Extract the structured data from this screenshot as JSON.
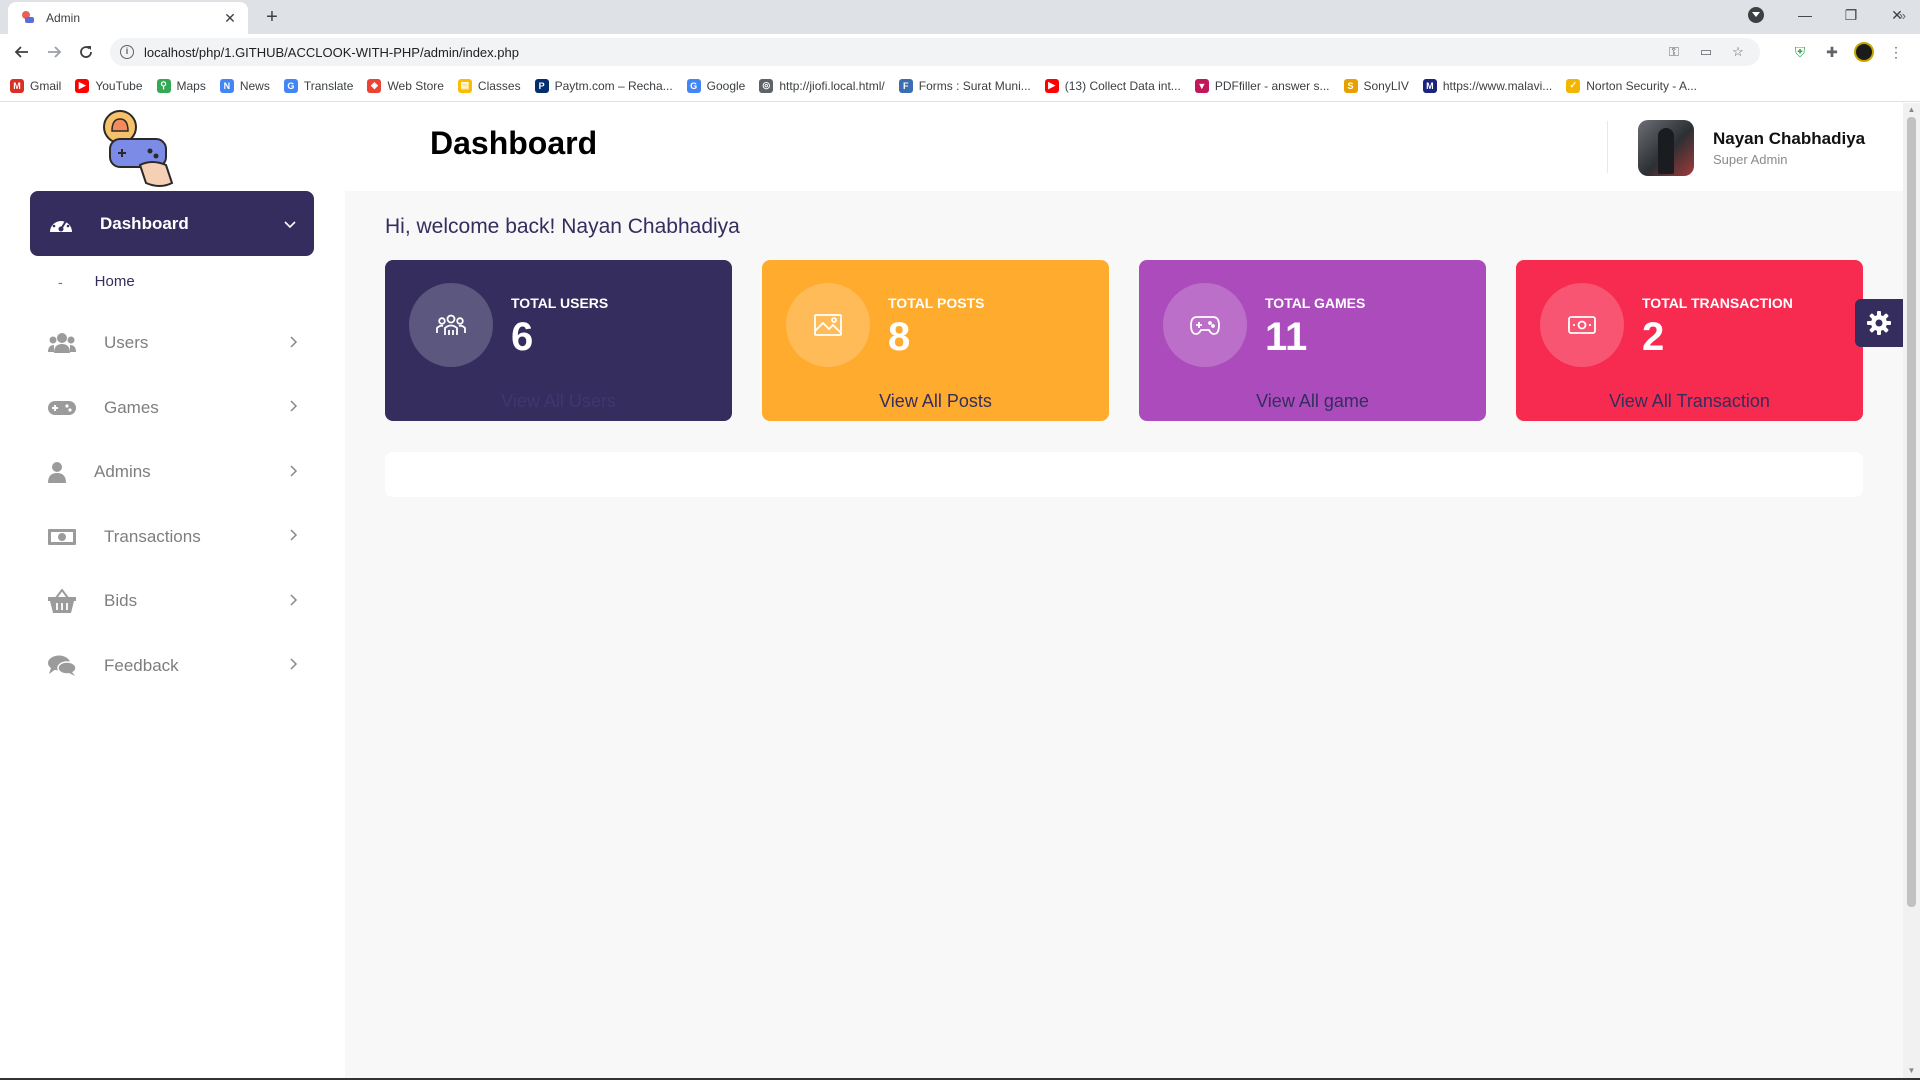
{
  "browser": {
    "tab_title": "Admin",
    "tab_close": "✕",
    "new_tab": "+",
    "url": "localhost/php/1.GITHUB/ACCLOOK-WITH-PHP/admin/index.php",
    "window_controls": {
      "minimize": "—",
      "restore": "❐",
      "close": "✕"
    },
    "bookmarks": [
      {
        "label": "Gmail",
        "color": "#d93025",
        "glyph": "M"
      },
      {
        "label": "YouTube",
        "color": "#ff0000",
        "glyph": "▶"
      },
      {
        "label": "Maps",
        "color": "#34a853",
        "glyph": "⚲"
      },
      {
        "label": "News",
        "color": "#4285f4",
        "glyph": "N"
      },
      {
        "label": "Translate",
        "color": "#4285f4",
        "glyph": "G"
      },
      {
        "label": "Web Store",
        "color": "#ea4335",
        "glyph": "◈"
      },
      {
        "label": "Classes",
        "color": "#fbbc04",
        "glyph": "▤"
      },
      {
        "label": "Paytm.com – Recha...",
        "color": "#002e6e",
        "glyph": "P"
      },
      {
        "label": "Google",
        "color": "#4285f4",
        "glyph": "G"
      },
      {
        "label": "http://jiofi.local.html/",
        "color": "#5f6368",
        "glyph": "◎"
      },
      {
        "label": "Forms : Surat Muni...",
        "color": "#3c6db0",
        "glyph": "F"
      },
      {
        "label": "(13) Collect Data int...",
        "color": "#ff0000",
        "glyph": "▶"
      },
      {
        "label": "PDFfiller - answer s...",
        "color": "#c2185b",
        "glyph": "▼"
      },
      {
        "label": "SonyLIV",
        "color": "#e6a100",
        "glyph": "S"
      },
      {
        "label": "https://www.malavi...",
        "color": "#1a237e",
        "glyph": "M"
      },
      {
        "label": "Norton Security - A...",
        "color": "#f2b600",
        "glyph": "✓"
      }
    ],
    "bookmarks_more": "»"
  },
  "sidebar": {
    "active": {
      "label": "Dashboard"
    },
    "sub_item": {
      "dash": "-",
      "label": "Home"
    },
    "items": [
      {
        "label": "Users",
        "icon": "users-icon"
      },
      {
        "label": "Games",
        "icon": "gamepad-icon"
      },
      {
        "label": "Admins",
        "icon": "user-icon"
      },
      {
        "label": "Transactions",
        "icon": "money-icon"
      },
      {
        "label": "Bids",
        "icon": "basket-icon"
      },
      {
        "label": "Feedback",
        "icon": "comments-icon"
      }
    ]
  },
  "header": {
    "title": "Dashboard",
    "user_name": "Nayan Chabhadiya",
    "user_role": "Super Admin"
  },
  "welcome": "Hi, welcome back! Nayan Chabhadiya",
  "stats": [
    {
      "label": "TOTAL USERS",
      "value": "6",
      "link": "View All Users",
      "icon": "users-group-icon",
      "bg": "#342d5e",
      "link_color": "#3e3770"
    },
    {
      "label": "TOTAL POSTS",
      "value": "8",
      "link": "View All Posts",
      "icon": "image-icon",
      "bg": "#ffab2e",
      "link_color": "#342d5e"
    },
    {
      "label": "TOTAL GAMES",
      "value": "11",
      "link": "View All game",
      "icon": "gamepad-icon",
      "bg": "#ac4cbc",
      "link_color": "#342d5e"
    },
    {
      "label": "TOTAL TRANSACTION",
      "value": "2",
      "link": "View All Transaction",
      "icon": "money-icon",
      "bg": "#f72b50",
      "link_color": "#342d5e"
    }
  ]
}
